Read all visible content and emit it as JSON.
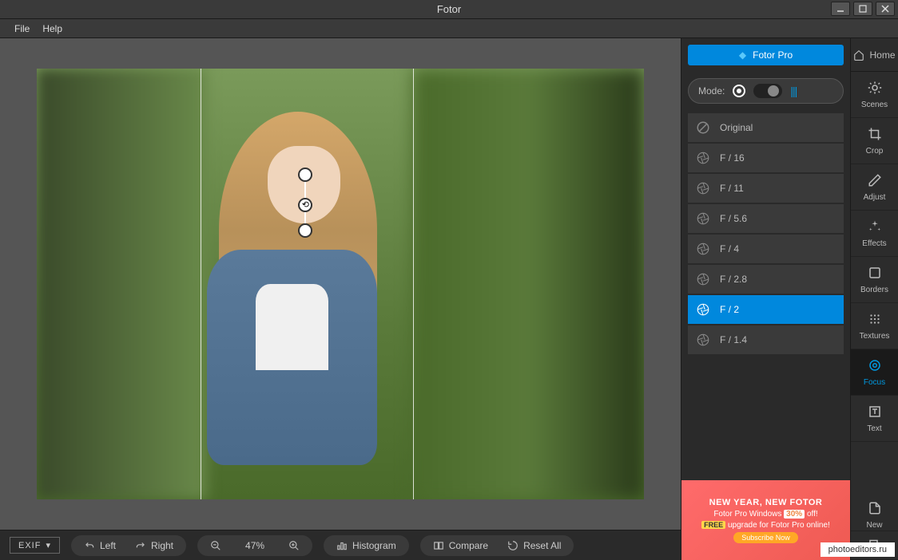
{
  "window": {
    "title": "Fotor"
  },
  "menu": {
    "file": "File",
    "help": "Help"
  },
  "topbar": {
    "fotor_pro": "Fotor Pro",
    "home": "Home"
  },
  "mode": {
    "label": "Mode:"
  },
  "focus_options": [
    {
      "label": "Original",
      "selected": false,
      "icon": "none"
    },
    {
      "label": "F / 16",
      "selected": false,
      "icon": "aperture"
    },
    {
      "label": "F / 11",
      "selected": false,
      "icon": "aperture"
    },
    {
      "label": "F / 5.6",
      "selected": false,
      "icon": "aperture"
    },
    {
      "label": "F / 4",
      "selected": false,
      "icon": "aperture"
    },
    {
      "label": "F / 2.8",
      "selected": false,
      "icon": "aperture"
    },
    {
      "label": "F / 2",
      "selected": true,
      "icon": "aperture"
    },
    {
      "label": "F / 1.4",
      "selected": false,
      "icon": "aperture"
    }
  ],
  "side_tools": [
    {
      "label": "Scenes",
      "icon": "sun",
      "active": false
    },
    {
      "label": "Crop",
      "icon": "crop",
      "active": false
    },
    {
      "label": "Adjust",
      "icon": "pencil",
      "active": false
    },
    {
      "label": "Effects",
      "icon": "sparkle",
      "active": false
    },
    {
      "label": "Borders",
      "icon": "border",
      "active": false
    },
    {
      "label": "Textures",
      "icon": "texture",
      "active": false
    },
    {
      "label": "Focus",
      "icon": "focus",
      "active": true
    },
    {
      "label": "Text",
      "icon": "text",
      "active": false
    }
  ],
  "side_tools_bottom": [
    {
      "label": "New",
      "icon": "new"
    },
    {
      "label": "",
      "icon": "export"
    }
  ],
  "bottom": {
    "exif": "EXIF",
    "left": "Left",
    "right": "Right",
    "zoom": "47%",
    "histogram": "Histogram",
    "compare": "Compare",
    "reset": "Reset All"
  },
  "promo": {
    "headline": "NEW YEAR, NEW FOTOR",
    "line1_a": "Fotor Pro Windows",
    "line1_discount": "30%",
    "line1_b": "off!",
    "line2_free": "FREE",
    "line2": "upgrade for Fotor Pro online!",
    "button": "Subscribe Now"
  },
  "watermark": "photoeditors.ru"
}
